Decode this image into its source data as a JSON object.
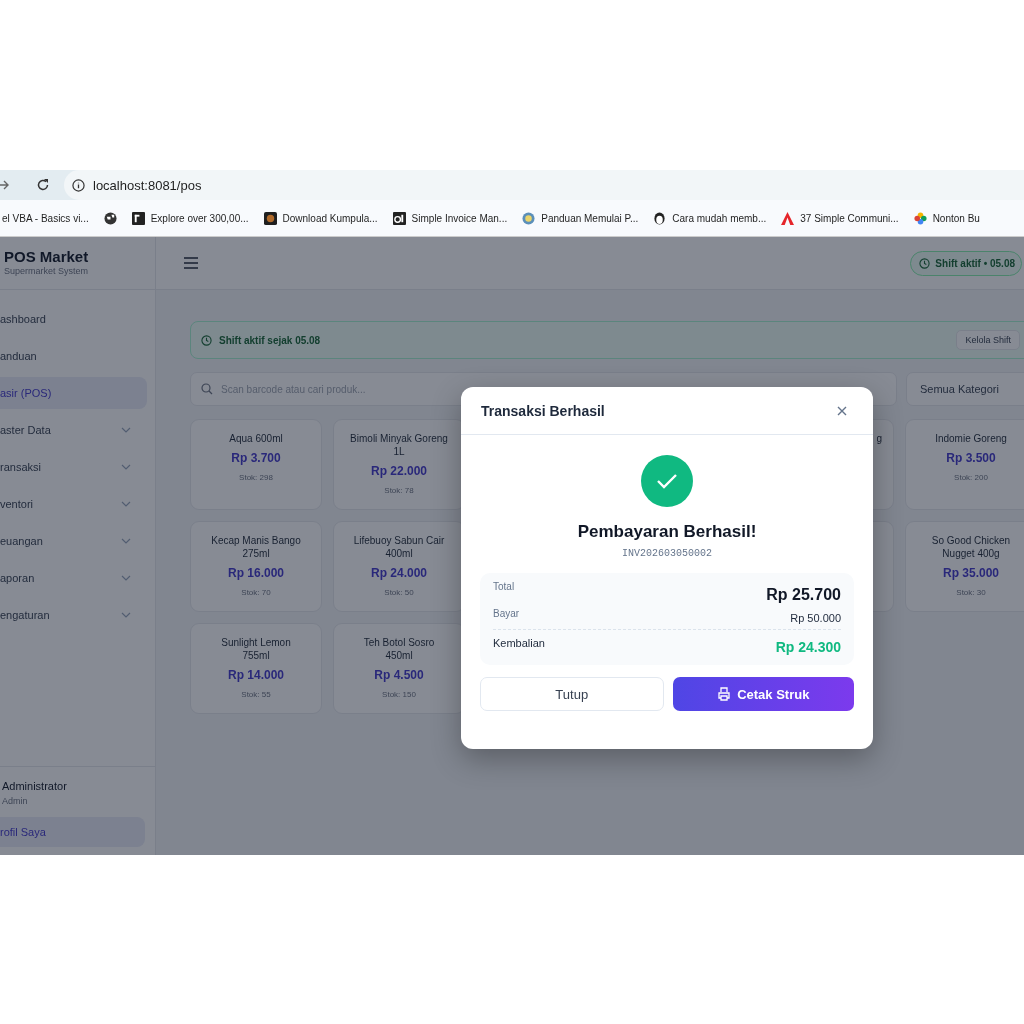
{
  "browser": {
    "url": "localhost:8081/pos",
    "bookmarks": [
      {
        "kind": "link",
        "label": "el VBA - Basics vi..."
      },
      {
        "kind": "icon"
      },
      {
        "kind": "link",
        "label": "Explore over 300,00..."
      },
      {
        "kind": "link",
        "label": "Download Kumpula..."
      },
      {
        "kind": "link",
        "label": "Simple Invoice Man..."
      },
      {
        "kind": "link",
        "label": "Panduan Memulai P..."
      },
      {
        "kind": "link",
        "label": "Cara mudah memb..."
      },
      {
        "kind": "link",
        "label": "37 Simple Communi..."
      },
      {
        "kind": "link",
        "label": "Nonton Bu"
      }
    ]
  },
  "sidebar": {
    "brand": "POS Market",
    "subtitle": "Supermarket System",
    "nav": [
      {
        "label": "ashboard",
        "selected": false,
        "expandable": false
      },
      {
        "label": "anduan",
        "selected": false,
        "expandable": false
      },
      {
        "label": "asir (POS)",
        "selected": true,
        "expandable": false
      },
      {
        "label": "aster Data",
        "selected": false,
        "expandable": true
      },
      {
        "label": "ransaksi",
        "selected": false,
        "expandable": true
      },
      {
        "label": "ventori",
        "selected": false,
        "expandable": true
      },
      {
        "label": "euangan",
        "selected": false,
        "expandable": true
      },
      {
        "label": "aporan",
        "selected": false,
        "expandable": true
      },
      {
        "label": "engaturan",
        "selected": false,
        "expandable": true
      }
    ],
    "user": {
      "name": "Administrator",
      "role": "Admin"
    },
    "profile_link": "rofil Saya"
  },
  "header": {
    "shift_badge": "Shift aktif • 05.08"
  },
  "shift_banner": {
    "text": "Shift aktif sejak 05.08",
    "button": "Kelola Shift"
  },
  "search": {
    "placeholder": "Scan barcode atau cari produk..."
  },
  "category_filter": {
    "value": "Semua Kategori"
  },
  "products": [
    {
      "kind": "product",
      "name": "Aqua 600ml",
      "price": "Rp 3.700",
      "stock": "Stok: 298"
    },
    {
      "kind": "product",
      "name": "Bimoli Minyak Goreng 1L",
      "price": "Rp 22.000",
      "stock": "Stok: 78"
    },
    {
      "kind": "hidden"
    },
    {
      "kind": "hidden"
    },
    {
      "kind": "partial",
      "name": "g"
    },
    {
      "kind": "product",
      "name": "Indomie Goreng",
      "price": "Rp 3.500",
      "stock": "Stok: 200"
    },
    {
      "kind": "product",
      "name": "Kecap Manis Bango 275ml",
      "price": "Rp 16.000",
      "stock": "Stok: 70"
    },
    {
      "kind": "product",
      "name": "Lifebuoy Sabun Cair 400ml",
      "price": "Rp 24.000",
      "stock": "Stok: 50"
    },
    {
      "kind": "hidden"
    },
    {
      "kind": "hidden"
    },
    {
      "kind": "covered"
    },
    {
      "kind": "product",
      "name": "So Good Chicken Nugget 400g",
      "price": "Rp 35.000",
      "stock": "Stok: 30"
    },
    {
      "kind": "product",
      "name": "Sunlight Lemon 755ml",
      "price": "Rp 14.000",
      "stock": "Stok: 55"
    },
    {
      "kind": "product",
      "name": "Teh Botol Sosro 450ml",
      "price": "Rp 4.500",
      "stock": "Stok: 150"
    }
  ],
  "modal": {
    "title": "Transaksi Berhasil",
    "heading": "Pembayaran Berhasil!",
    "invoice": "INV202603050002",
    "summary": [
      {
        "kind": "total",
        "label": "Total",
        "value": "Rp 25.700"
      },
      {
        "kind": "paid",
        "label": "Bayar",
        "value": "Rp 50.000"
      },
      {
        "kind": "change",
        "label": "Kembalian",
        "value": "Rp 24.300"
      }
    ],
    "buttons": [
      {
        "kind": "secondary",
        "label": "Tutup"
      },
      {
        "kind": "primary",
        "label": "Cetak Struk"
      }
    ]
  }
}
